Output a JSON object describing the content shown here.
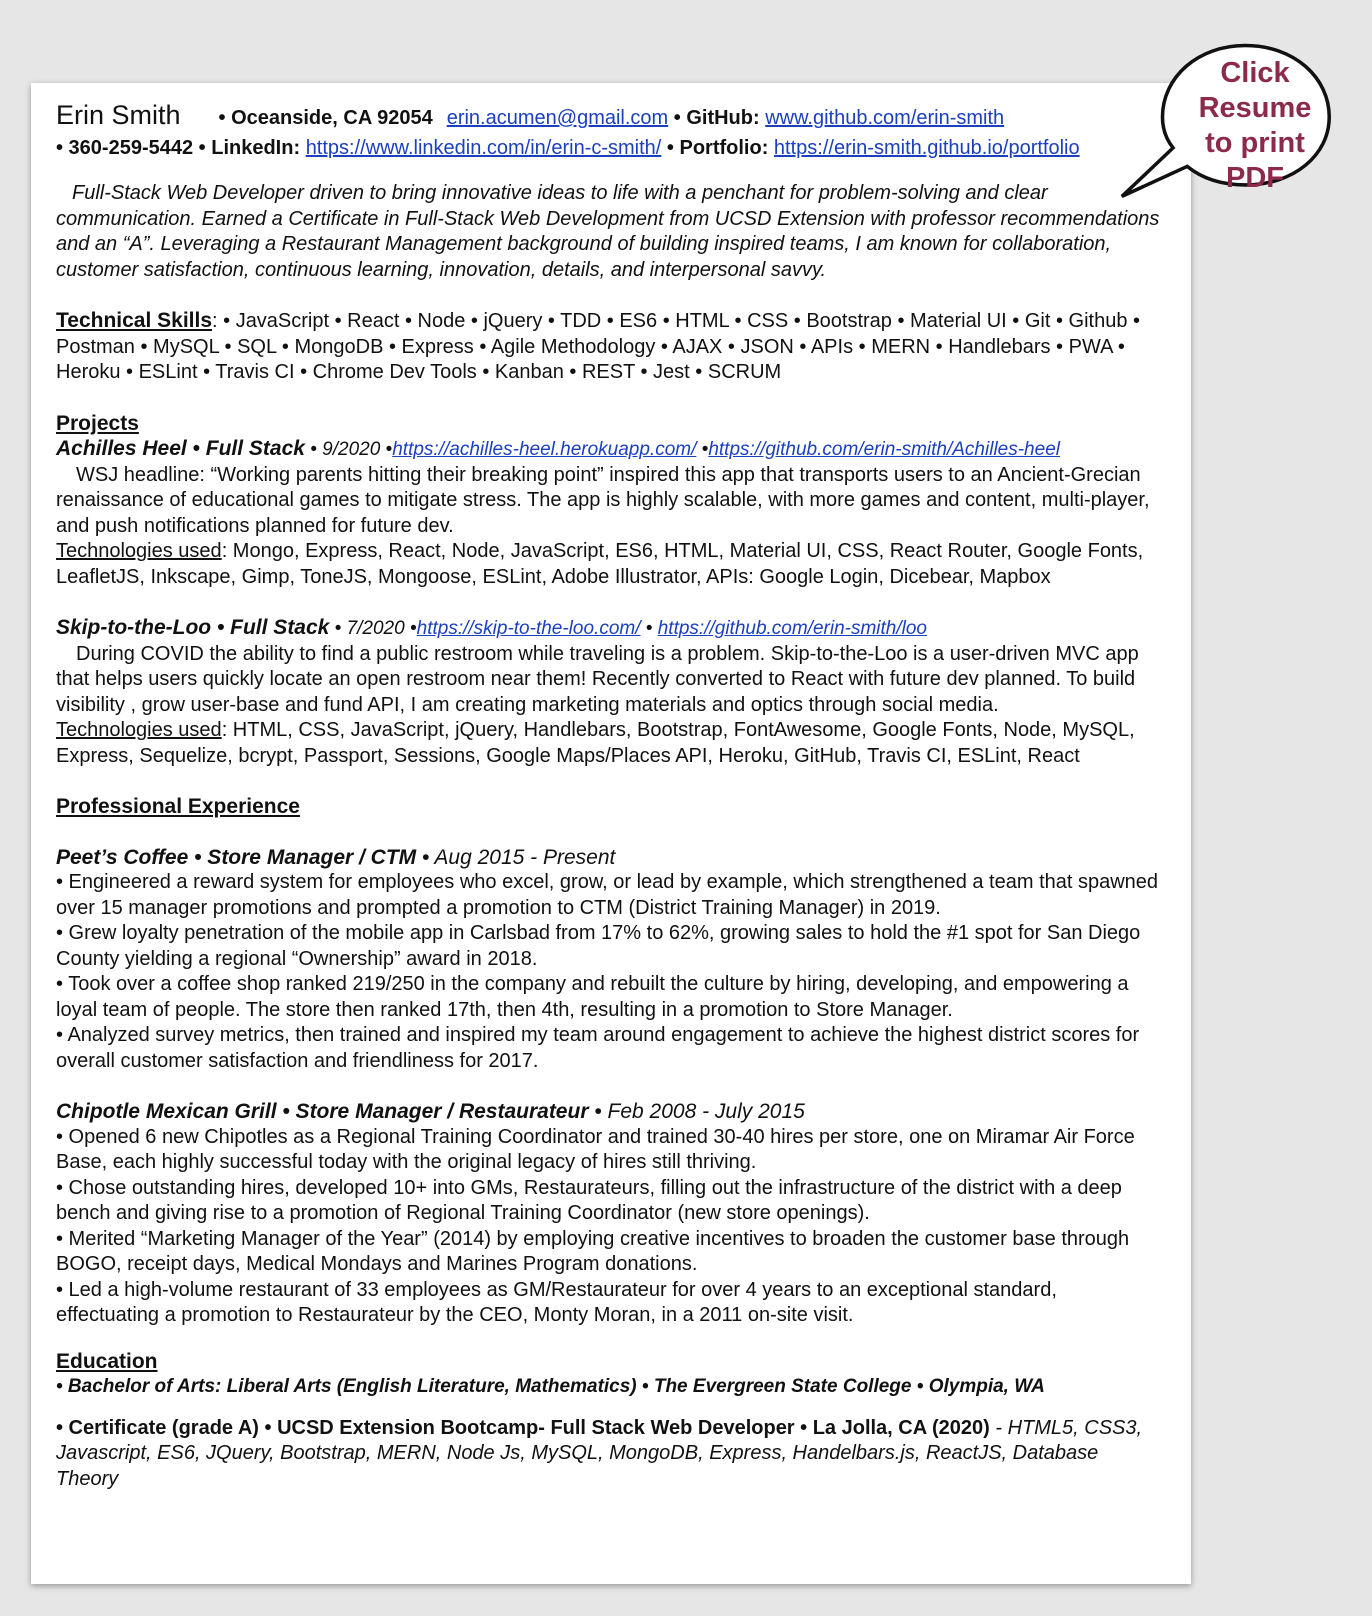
{
  "header": {
    "name": "Erin Smith",
    "location": "• Oceanside, CA 92054",
    "email": "erin.acumen@gmail.com",
    "github_label": "• GitHub:",
    "github_url": "www.github.com/erin-smith",
    "phone": "• 360-259-5442",
    "linkedin_label": "• LinkedIn:",
    "linkedin_url": "https://www.linkedin.com/in/erin-c-smith/",
    "portfolio_label": "• Portfolio:",
    "portfolio_url": "https://erin-smith.github.io/portfolio"
  },
  "summary": "Full-Stack Web Developer driven to bring innovative ideas to life with a penchant for problem-solving and clear communication.  Earned a Certificate in Full-Stack Web Development from UCSD Extension with professor recommendations and an “A”.  Leveraging a Restaurant Management background of building inspired teams, I am known for collaboration, customer satisfaction, continuous learning, innovation, details, and interpersonal savvy.",
  "skills": {
    "title": "Technical Skills",
    "text": ":  • JavaScript • React • Node • jQuery • TDD • ES6 • HTML • CSS • Bootstrap • Material UI • Git • Github • Postman • MySQL • SQL • MongoDB • Express • Agile Methodology • AJAX • JSON • APIs • MERN • Handlebars • PWA • Heroku  • ESLint  • Travis CI  • Chrome Dev Tools • Kanban • REST • Jest • SCRUM"
  },
  "projects": {
    "title": "Projects",
    "items": [
      {
        "name": "Achilles Heel • Full Stack",
        "date": " • 9/2020 •",
        "link1": "https://achilles-heel.herokuapp.com/",
        "sep": " •",
        "link2": "https://github.com/erin-smith/Achilles-heel",
        "description": "WSJ headline: “Working parents hitting their breaking point” inspired this app that transports users to an Ancient-Grecian renaissance of educational games to mitigate stress. The app is highly scalable, with more games and content, multi-player, and push notifications planned for future dev.",
        "tech_label": "Technologies used",
        "tech": ": Mongo, Express, React, Node, JavaScript, ES6, HTML, Material UI, CSS, React Router, Google Fonts, LeafletJS, Inkscape, Gimp, ToneJS, Mongoose, ESLint, Adobe Illustrator, APIs: Google Login, Dicebear, Mapbox"
      },
      {
        "name": "Skip-to-the-Loo • Full Stack",
        "date": " • 7/2020 •",
        "link1": "https://skip-to-the-loo.com/",
        "sep": " • ",
        "link2": "https://github.com/erin-smith/loo",
        "description": "During COVID the ability to find a public restroom while traveling is a problem. Skip-to-the-Loo is  a user-driven MVC app that helps users quickly locate an open restroom near them!  Recently converted to React with future dev planned. To build visibility , grow user-base and fund API, I am creating marketing materials and optics through social media.",
        "tech_label": "Technologies used",
        "tech": ": HTML, CSS, JavaScript, jQuery, Handlebars, Bootstrap, FontAwesome, Google Fonts, Node, MySQL, Express, Sequelize, bcrypt, Passport, Sessions, Google Maps/Places API, Heroku, GitHub, Travis CI, ESLint, React"
      }
    ]
  },
  "experience": {
    "title": "Professional Experience",
    "jobs": [
      {
        "title": "Peet’s Coffee • Store Manager / CTM",
        "dates": " • Aug 2015 - Present",
        "bullets": [
          "• Engineered a reward system for employees who excel, grow, or lead by example, which strengthened a team that spawned over 15 manager promotions and prompted a promotion to CTM (District Training Manager) in 2019.",
          "• Grew loyalty penetration of the mobile app in Carlsbad from 17% to 62%, growing sales to hold the #1 spot for San Diego County yielding a regional “Ownership” award in 2018.",
          "• Took over a coffee shop ranked 219/250 in the company and rebuilt the culture by hiring, developing, and empowering a loyal team of people. The store then ranked 17th, then 4th, resulting in a promotion to Store Manager.",
          "• Analyzed survey metrics, then trained and inspired my team around engagement to achieve the highest district scores for overall customer satisfaction and friendliness for 2017."
        ]
      },
      {
        "title": "Chipotle Mexican Grill • Store Manager / Restaurateur",
        "dates": " • Feb 2008 - July 2015",
        "bullets": [
          "• Opened 6 new Chipotles as a Regional Training Coordinator and trained 30-40 hires per store, one on Miramar Air Force Base, each highly successful today with the original legacy of hires still thriving.",
          "• Chose outstanding hires, developed 10+ into GMs, Restaurateurs, filling out the infrastructure of the district with a deep bench and giving rise to a promotion of Regional Training Coordinator (new store openings).",
          "• Merited “Marketing Manager of the Year” (2014) by employing creative incentives to broaden the customer base through BOGO, receipt days, Medical Mondays and Marines Program donations.",
          "• Led a high-volume restaurant of 33 employees as GM/Restaurateur for over 4 years to an exceptional standard, effectuating a promotion to Restaurateur by the CEO, Monty Moran, in a 2011 on-site visit."
        ]
      }
    ]
  },
  "education": {
    "title": "Education",
    "degree": "•  Bachelor of Arts: Liberal Arts (English Literature, Mathematics) • The Evergreen State College • Olympia, WA",
    "certificate": "• Certificate (grade A) • UCSD Extension Bootcamp- Full Stack Web Developer • La Jolla, CA (2020) ",
    "certificate_detail": " - HTML5, CSS3, Javascript, ES6, JQuery, Bootstrap, MERN, Node Js, MySQL, MongoDB, Express, Handelbars.js, ReactJS, Database Theory"
  },
  "callout": {
    "lines": [
      "Click",
      "Resume",
      "to print",
      "PDF"
    ],
    "text_color": "#8b2a4a"
  }
}
